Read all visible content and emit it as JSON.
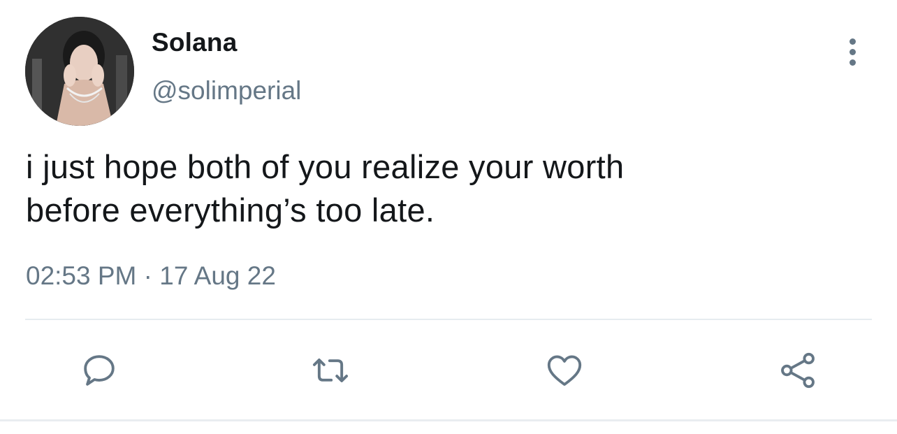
{
  "user": {
    "display_name": "Solana",
    "handle": "@solimperial"
  },
  "tweet": {
    "text_line1": "i just hope both of you realize your worth",
    "text_line2": "before everything’s too late.",
    "timestamp": "02:53 PM · 17 Aug 22"
  },
  "actions": {
    "reply_icon": "reply-icon",
    "retweet_icon": "retweet-icon",
    "like_icon": "heart-icon",
    "share_icon": "share-icon"
  },
  "colors": {
    "text": "#14171a",
    "secondary": "#657786",
    "divider": "#e6ecf0"
  }
}
